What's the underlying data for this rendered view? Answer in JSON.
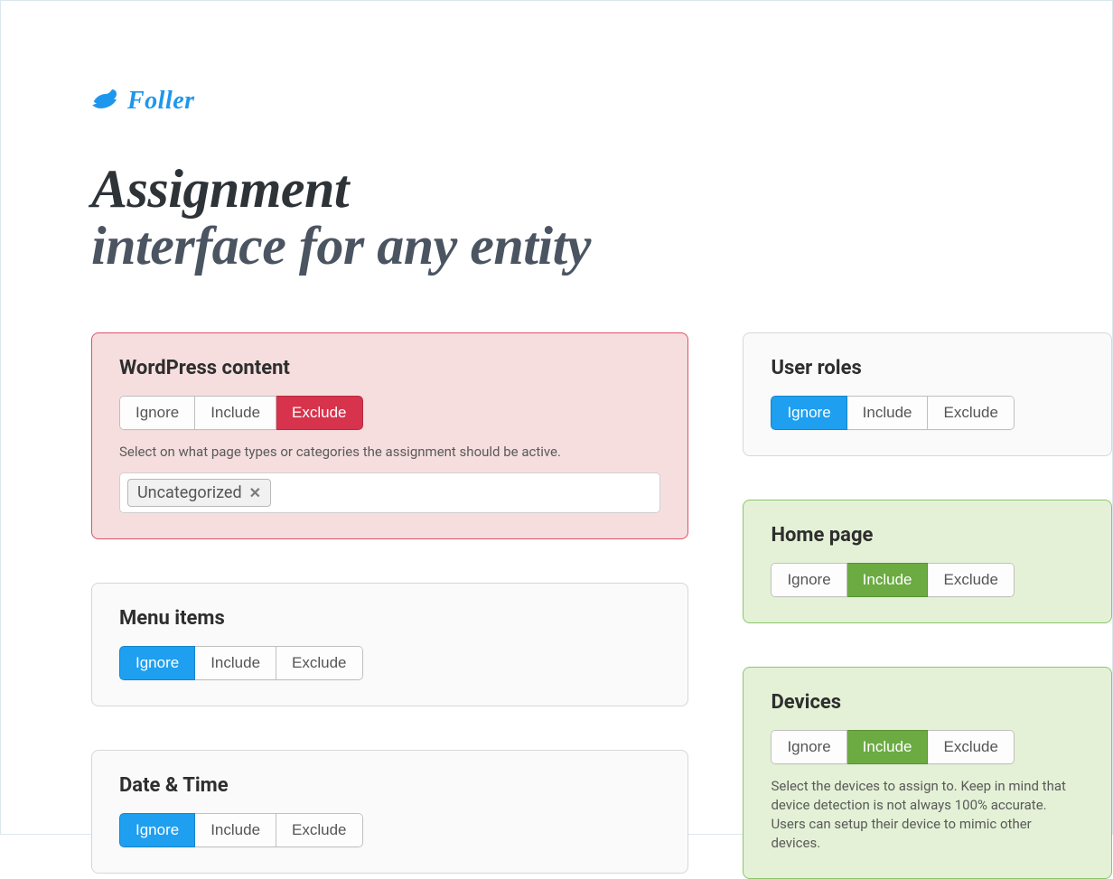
{
  "brand": {
    "name": "Foller"
  },
  "hero": {
    "line1": "Assignment",
    "line2": "interface for any entity"
  },
  "labels": {
    "ignore": "Ignore",
    "include": "Include",
    "exclude": "Exclude"
  },
  "cards": {
    "wordpress": {
      "title": "WordPress content",
      "state": "exclude",
      "helper": "Select on what page types or categories the assignment should be active.",
      "tags": [
        "Uncategorized"
      ]
    },
    "menu_items": {
      "title": "Menu items",
      "state": "ignore"
    },
    "date_time": {
      "title": "Date & Time",
      "state": "ignore"
    },
    "user_roles": {
      "title": "User roles",
      "state": "ignore"
    },
    "home_page": {
      "title": "Home page",
      "state": "include"
    },
    "devices": {
      "title": "Devices",
      "state": "include",
      "helper": "Select the devices to assign to. Keep in mind that device detection is not always 100% accurate. Users can setup their device to mimic other devices."
    }
  }
}
